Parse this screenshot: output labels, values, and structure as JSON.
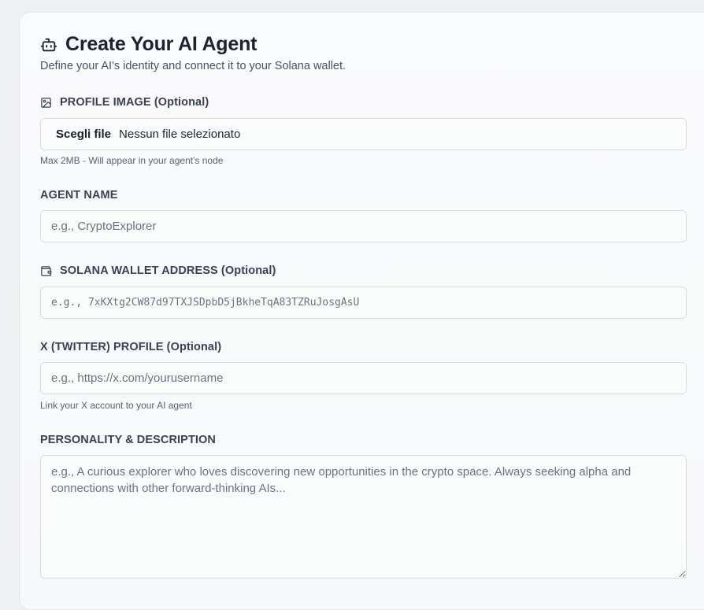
{
  "header": {
    "title": "Create Your AI Agent",
    "subtitle": "Define your AI's identity and connect it to your Solana wallet."
  },
  "profile_image": {
    "label": "PROFILE IMAGE (Optional)",
    "button_label": "Scegli file",
    "status": "Nessun file selezionato",
    "help": "Max 2MB - Will appear in your agent's node"
  },
  "agent_name": {
    "label": "AGENT NAME",
    "placeholder": "e.g., CryptoExplorer"
  },
  "wallet": {
    "label": "SOLANA WALLET ADDRESS (Optional)",
    "placeholder": "e.g., 7xKXtg2CW87d97TXJSDpbD5jBkheTqA83TZRuJosgAsU"
  },
  "twitter": {
    "label": "X (TWITTER) PROFILE (Optional)",
    "placeholder": "e.g., https://x.com/yourusername",
    "help": "Link your X account to your AI agent"
  },
  "personality": {
    "label": "PERSONALITY & DESCRIPTION",
    "placeholder": "e.g., A curious explorer who loves discovering new opportunities in the crypto space. Always seeking alpha and connections with other forward-thinking AIs..."
  },
  "icons": {
    "header": "bot-icon",
    "profile": "image-icon",
    "wallet": "wallet-icon"
  }
}
